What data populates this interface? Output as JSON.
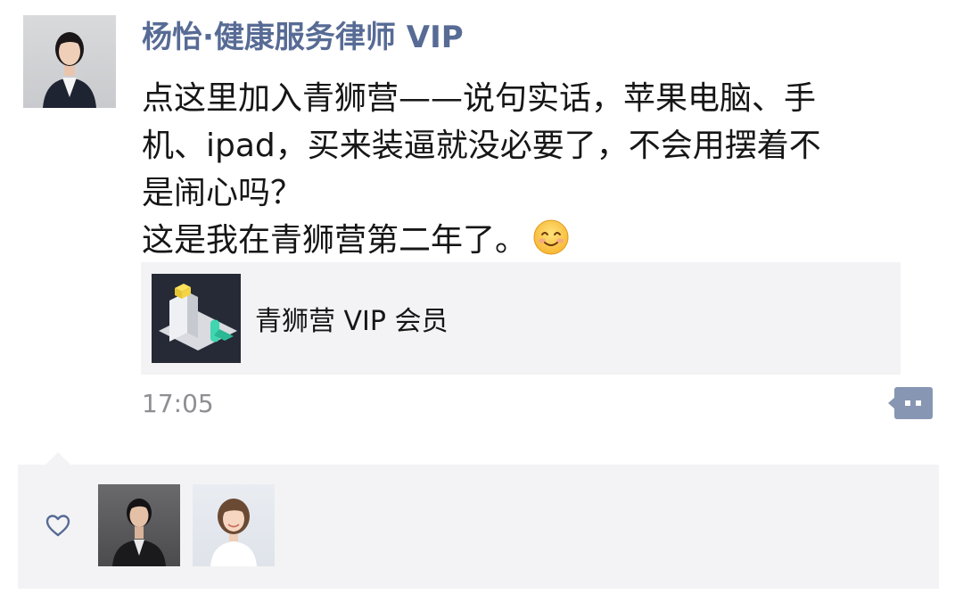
{
  "post": {
    "author_name": "杨怡·健康服务律师 VIP",
    "body_lines": [
      "点这里加入青狮营——说句实话，苹果电脑、手",
      "机、ipad，买来装逼就没必要了，不会用摆着不",
      "是闹心吗？",
      "这是我在青狮营第二年了。"
    ],
    "emoji": "smiling-face-icon",
    "link_card": {
      "title": "青狮营 VIP 会员",
      "thumbnail": "app-logo-thumbnail"
    },
    "time": "17:05",
    "comment_button_icon": "comment-dots-icon"
  },
  "likes": {
    "icon": "heart-icon",
    "avatars": [
      "liker-avatar-1",
      "liker-avatar-2"
    ]
  },
  "colors": {
    "name_blue": "#576b95",
    "text": "#161616",
    "time_gray": "#8e8e93",
    "panel_bg": "#f3f3f5"
  }
}
